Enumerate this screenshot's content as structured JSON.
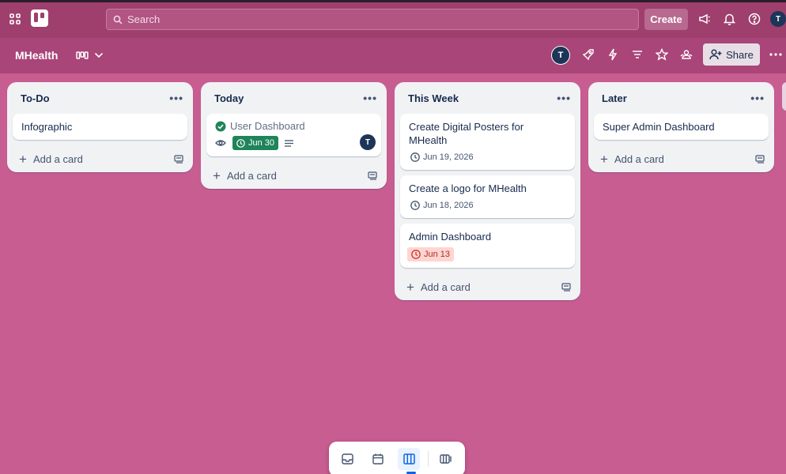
{
  "topbar": {
    "search_placeholder": "Search",
    "create_label": "Create",
    "user_initial": "T"
  },
  "board": {
    "title": "MHealth",
    "share_label": "Share",
    "member_initial": "T"
  },
  "lists": [
    {
      "name": "To-Do",
      "cards": [
        {
          "title": "Infographic"
        }
      ],
      "add_card_label": "Add a card"
    },
    {
      "name": "Today",
      "cards": [
        {
          "title": "User Dashboard",
          "completed": true,
          "due": "Jun 30",
          "due_status": "complete",
          "has_watch": true,
          "has_description": true,
          "member_initial": "T"
        }
      ],
      "add_card_label": "Add a card"
    },
    {
      "name": "This Week",
      "cards": [
        {
          "title": "Create Digital Posters for MHealth",
          "due": "Jun 19, 2026"
        },
        {
          "title": "Create a logo for MHealth",
          "due": "Jun 18, 2026"
        },
        {
          "title": "Admin Dashboard",
          "due": "Jun 13",
          "due_status": "overdue"
        }
      ],
      "add_card_label": "Add a card"
    },
    {
      "name": "Later",
      "cards": [
        {
          "title": "Super Admin Dashboard"
        }
      ],
      "add_card_label": "Add a card"
    }
  ],
  "view_switcher": {
    "items": [
      "inbox-icon",
      "calendar-icon",
      "board-icon",
      "switch-boards-icon"
    ],
    "active": "board-icon"
  },
  "colors": {
    "board_background": "#c85d92",
    "topbar": "#9e3f6d",
    "complete_green": "#1f845a",
    "overdue_red": "#ffd5d2",
    "accent_blue": "#0c66e4"
  }
}
